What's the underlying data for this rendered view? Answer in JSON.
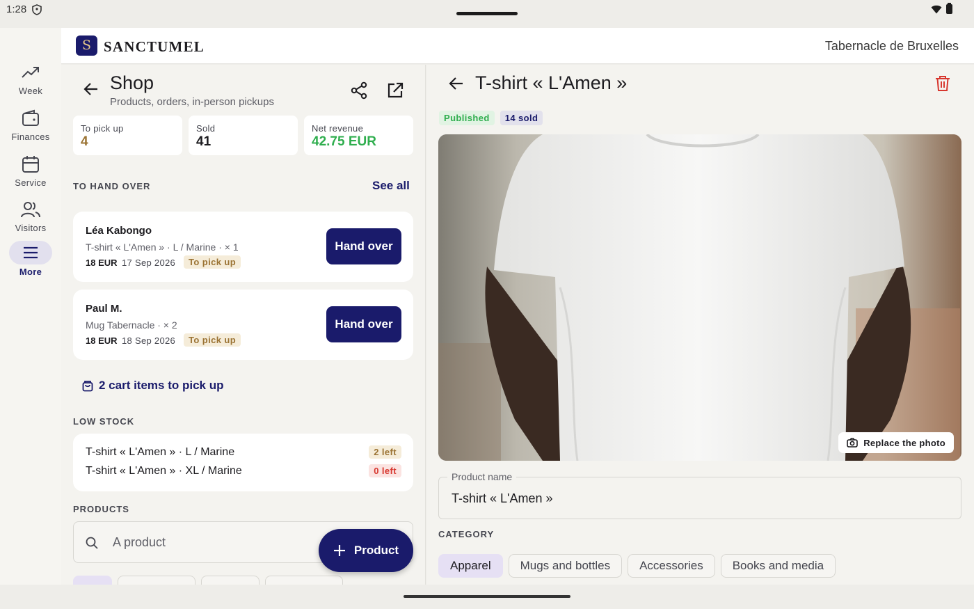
{
  "status_bar": {
    "time": "1:28"
  },
  "app": {
    "logo_letter": "S",
    "brand": "SANCTUMEL",
    "church": "Tabernacle de Bruxelles"
  },
  "nav": {
    "items": [
      {
        "label": "Week",
        "icon": "trending-up-icon"
      },
      {
        "label": "Finances",
        "icon": "wallet-icon"
      },
      {
        "label": "Service",
        "icon": "calendar-icon"
      },
      {
        "label": "Visitors",
        "icon": "people-icon"
      },
      {
        "label": "More",
        "icon": "menu-icon",
        "active": true
      }
    ]
  },
  "shop": {
    "title": "Shop",
    "subtitle": "Products, orders, in-person pickups",
    "stats": [
      {
        "label": "To pick up",
        "value": "4",
        "color": "#9b7333"
      },
      {
        "label": "Sold",
        "value": "41",
        "color": "#1c1b1f"
      },
      {
        "label": "Net revenue",
        "value": "42.75 EUR",
        "color": "#2fae4e"
      }
    ],
    "handover": {
      "title": "TO HAND OVER",
      "see_all": "See all",
      "orders": [
        {
          "name": "Léa Kabongo",
          "item": "T-shirt « L'Amen » · L / Marine · × 1",
          "price": "18 EUR",
          "date": "17 Sep 2026",
          "status": "To pick up",
          "button": "Hand over"
        },
        {
          "name": "Paul M.",
          "item": "Mug Tabernacle · × 2",
          "price": "18 EUR",
          "date": "18 Sep 2026",
          "status": "To pick up",
          "button": "Hand over"
        }
      ]
    },
    "cart_link": "2 cart items to pick up",
    "low_stock": {
      "title": "LOW STOCK",
      "items": [
        {
          "name": "T-shirt « L'Amen » · L / Marine",
          "badge": "2 left",
          "badge_bg": "#f5ecd9",
          "badge_color": "#9b7333"
        },
        {
          "name": "T-shirt « L'Amen » · XL / Marine",
          "badge": "0 left",
          "badge_bg": "#fbe3e1",
          "badge_color": "#d7372f"
        }
      ]
    },
    "products": {
      "title": "PRODUCTS",
      "search_placeholder": "A product",
      "fab_label": "Product"
    }
  },
  "product": {
    "title": "T-shirt « L'Amen »",
    "published": "Published",
    "sold": "14 sold",
    "replace_photo": "Replace the photo",
    "name_label": "Product name",
    "name_value": "T-shirt « L'Amen »",
    "category_title": "CATEGORY",
    "categories": [
      {
        "label": "Apparel",
        "selected": true
      },
      {
        "label": "Mugs and bottles",
        "selected": false
      },
      {
        "label": "Accessories",
        "selected": false
      },
      {
        "label": "Books and media",
        "selected": false
      }
    ]
  },
  "colors": {
    "primary": "#1a1b6b",
    "danger": "#d7372f",
    "success": "#2fae4e",
    "warning": "#9b7333"
  }
}
